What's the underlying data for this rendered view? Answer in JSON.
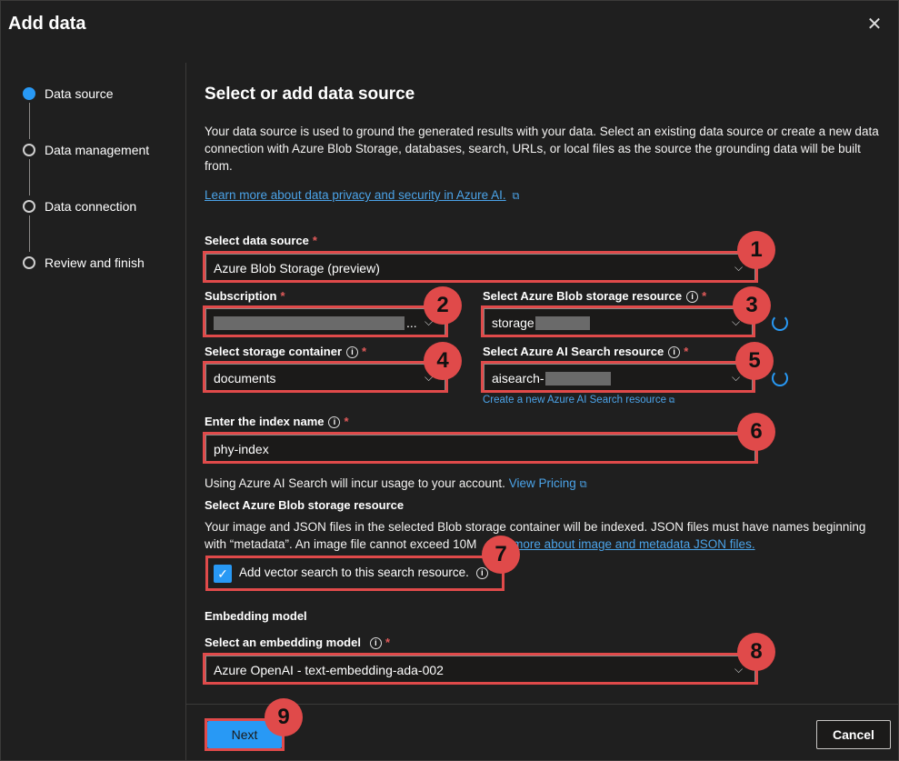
{
  "dialog": {
    "title": "Add data",
    "close_icon": "close-icon"
  },
  "steps": [
    {
      "label": "Data source",
      "active": true
    },
    {
      "label": "Data management",
      "active": false
    },
    {
      "label": "Data connection",
      "active": false
    },
    {
      "label": "Review and finish",
      "active": false
    }
  ],
  "main": {
    "heading": "Select or add data source",
    "description": "Your data source is used to ground the generated results with your data. Select an existing data source or create a new data connection with Azure Blob Storage, databases, search, URLs, or local files as the source the grounding data will be built from.",
    "learn_link": "Learn more about data privacy and security in Azure AI.",
    "data_source": {
      "label": "Select data source",
      "value": "Azure Blob Storage (preview)"
    },
    "subscription": {
      "label": "Subscription",
      "value_suffix": "..."
    },
    "blob_resource": {
      "label": "Select Azure Blob storage resource",
      "value_prefix": "storage"
    },
    "container": {
      "label": "Select storage container",
      "value": "documents"
    },
    "search_resource": {
      "label": "Select Azure AI Search resource",
      "value_prefix": "aisearch-"
    },
    "create_search_link": "Create a new Azure AI Search resource",
    "index_name": {
      "label": "Enter the index name",
      "value": "phy-index"
    },
    "usage_text": "Using Azure AI Search will incur usage to your account.",
    "view_pricing": "View Pricing",
    "blob_section_heading": "Select Azure Blob storage resource",
    "blob_info_line1": "Your image and JSON files in the selected Blob storage container will be indexed. JSON files must have names beginning",
    "blob_info_line2": "with “metadata”. An image file cannot exceed 10M",
    "blob_info_link": "rn more about image and metadata JSON files.",
    "vector_checkbox": {
      "label": "Add vector search to this search resource.",
      "checked": true
    },
    "embedding_heading": "Embedding model",
    "embedding": {
      "label": "Select an embedding model",
      "value": "Azure OpenAI - text-embedding-ada-002"
    }
  },
  "footer": {
    "next": "Next",
    "cancel": "Cancel"
  },
  "callouts": [
    "1",
    "2",
    "3",
    "4",
    "5",
    "6",
    "7",
    "8",
    "9"
  ],
  "colors": {
    "accent": "#2899f5",
    "highlight": "#e04a4a",
    "background": "#1f1f1f"
  }
}
